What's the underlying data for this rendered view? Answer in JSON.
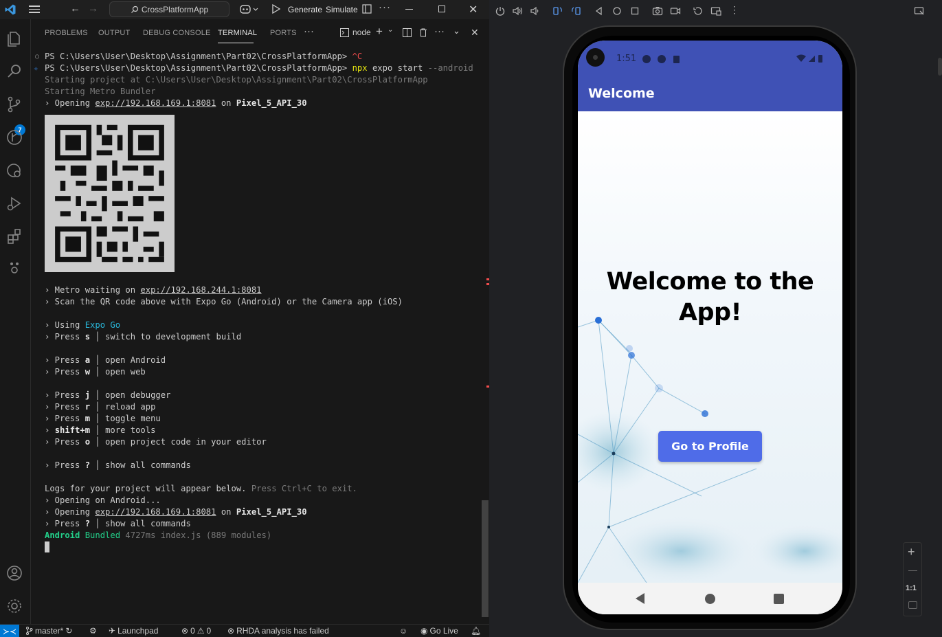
{
  "titlebar": {
    "search_text": "CrossPlatformApp",
    "generate_label": "Generate",
    "simulate_label": "Simulate"
  },
  "activitybar": {
    "source_control_badge": "7"
  },
  "panel": {
    "tabs": [
      "PROBLEMS",
      "OUTPUT",
      "DEBUG CONSOLE",
      "TERMINAL",
      "PORTS"
    ],
    "active_tab": "TERMINAL",
    "terminal_name": "node"
  },
  "terminal": {
    "l1_prompt": "PS C:\\Users\\User\\Desktop\\Assignment\\Part02\\CrossPlatformApp> ",
    "l1_cmd": "^C",
    "l2_prompt": "PS C:\\Users\\User\\Desktop\\Assignment\\Part02\\CrossPlatformApp> ",
    "l2_npx": "npx",
    "l2_cmd": " expo start ",
    "l2_flag": "--android",
    "l3": "Starting project at C:\\Users\\User\\Desktop\\Assignment\\Part02\\CrossPlatformApp",
    "l4": "Starting Metro Bundler",
    "l5_pre": "› Opening ",
    "l5_url": "exp://192.168.169.1:8081",
    "l5_mid": " on ",
    "l5_dev": "Pixel_5_API_30",
    "metro_pre": "› Metro waiting on ",
    "metro_url": "exp://192.168.244.1:8081",
    "scan": "› Scan the QR code above with Expo Go (Android) or the Camera app (iOS)",
    "using_pre": "› Using ",
    "using_app": "Expo Go",
    "press_s_pre": "› Press ",
    "press_s_key": "s",
    "press_s_desc": " │ switch to development build",
    "press_a_key": "a",
    "press_a_desc": " │ open Android",
    "press_w_key": "w",
    "press_w_desc": " │ open web",
    "press_j_key": "j",
    "press_j_desc": " │ open debugger",
    "press_r_key": "r",
    "press_r_desc": " │ reload app",
    "press_m_key": "m",
    "press_m_desc": " │ toggle menu",
    "shift_key": "shift+m",
    "shift_desc": " │ more tools",
    "press_o_key": "o",
    "press_o_desc": " │ open project code in your editor",
    "press_q_key": "?",
    "press_q_desc": " │ show all commands",
    "logs_pre": "Logs for your project will appear below. ",
    "logs_dim": "Press Ctrl+C to exit.",
    "opening_android": "› Opening on Android...",
    "open2_url": "exp://192.168.169.1:8081",
    "open2_dev": "Pixel_5_API_30",
    "press_q2_desc": " │ show all commands",
    "bundled_a": "Android",
    "bundled_b": " Bundled ",
    "bundled_c": "4727ms index.js (889 modules)"
  },
  "statusbar": {
    "branch": "master*",
    "launchpad": "Launchpad",
    "errors": "0",
    "warnings": "0",
    "rhda": "RHDA analysis has failed",
    "golive": "Go Live"
  },
  "phone": {
    "time": "1:51",
    "appbar_title": "Welcome",
    "welcome_line1": "Welcome to the",
    "welcome_line2": "App!",
    "button_label": "Go to Profile",
    "accent_color": "#3f51b5",
    "button_color": "#4f6ce8"
  },
  "emulator": {
    "zoom_label": "1:1"
  }
}
